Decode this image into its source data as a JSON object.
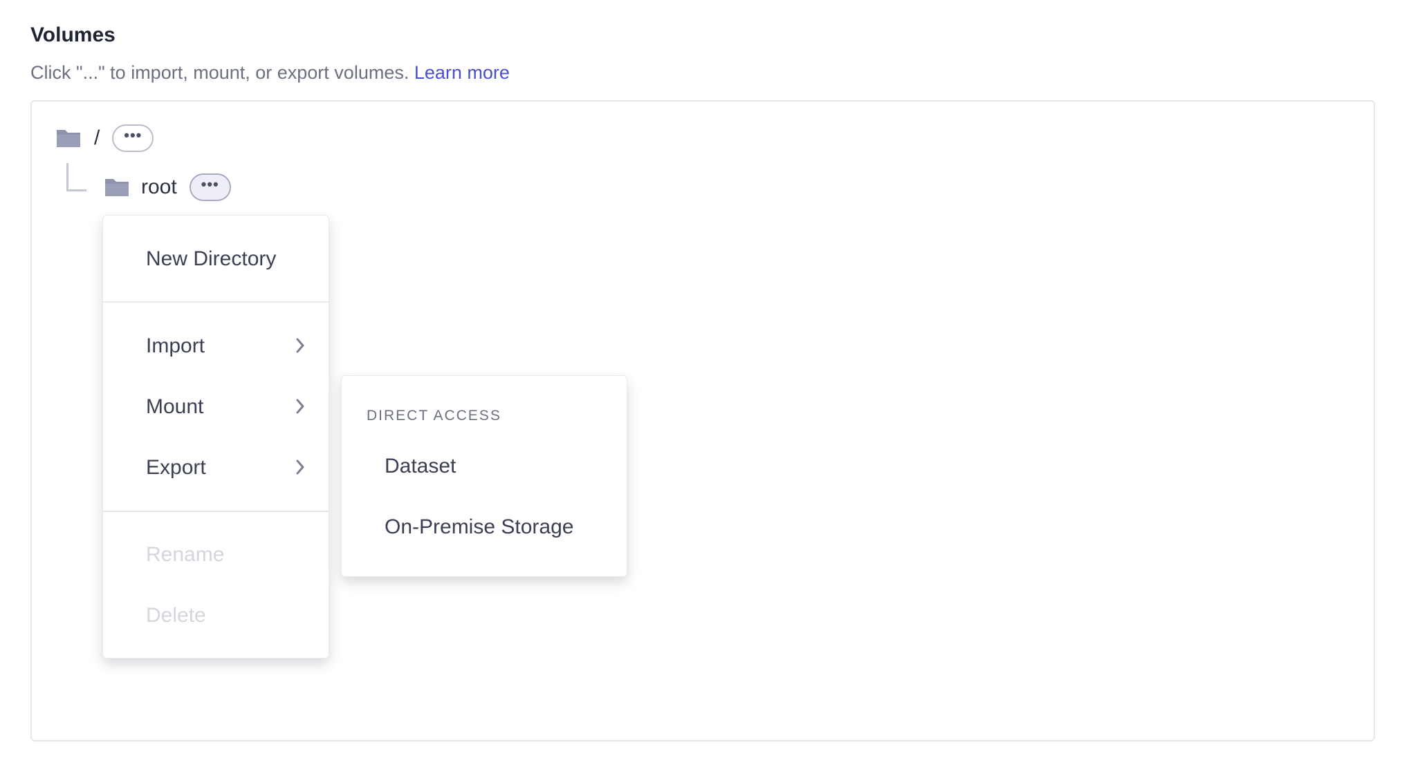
{
  "section": {
    "title": "Volumes",
    "description": "Click \"...\" to import, mount, or export volumes.",
    "learn_more": "Learn more"
  },
  "tree": {
    "root_node": {
      "label": "/",
      "more": "•••"
    },
    "child_node": {
      "label": "root",
      "more": "•••"
    }
  },
  "context_menu": {
    "new_directory": "New Directory",
    "import": "Import",
    "mount": "Mount",
    "export": "Export",
    "rename": "Rename",
    "delete": "Delete"
  },
  "submenu": {
    "header": "DIRECT ACCESS",
    "items": [
      "Dataset",
      "On-Premise Storage"
    ]
  },
  "colors": {
    "folder": "#8e92ac",
    "link": "#4b4fcf",
    "disabled_text": "#d4d6de",
    "chevron": "#7a7e93"
  },
  "icons": {
    "folder": "folder-icon",
    "more": "more-horizontal-icon",
    "chevron": "chevron-right-icon"
  }
}
